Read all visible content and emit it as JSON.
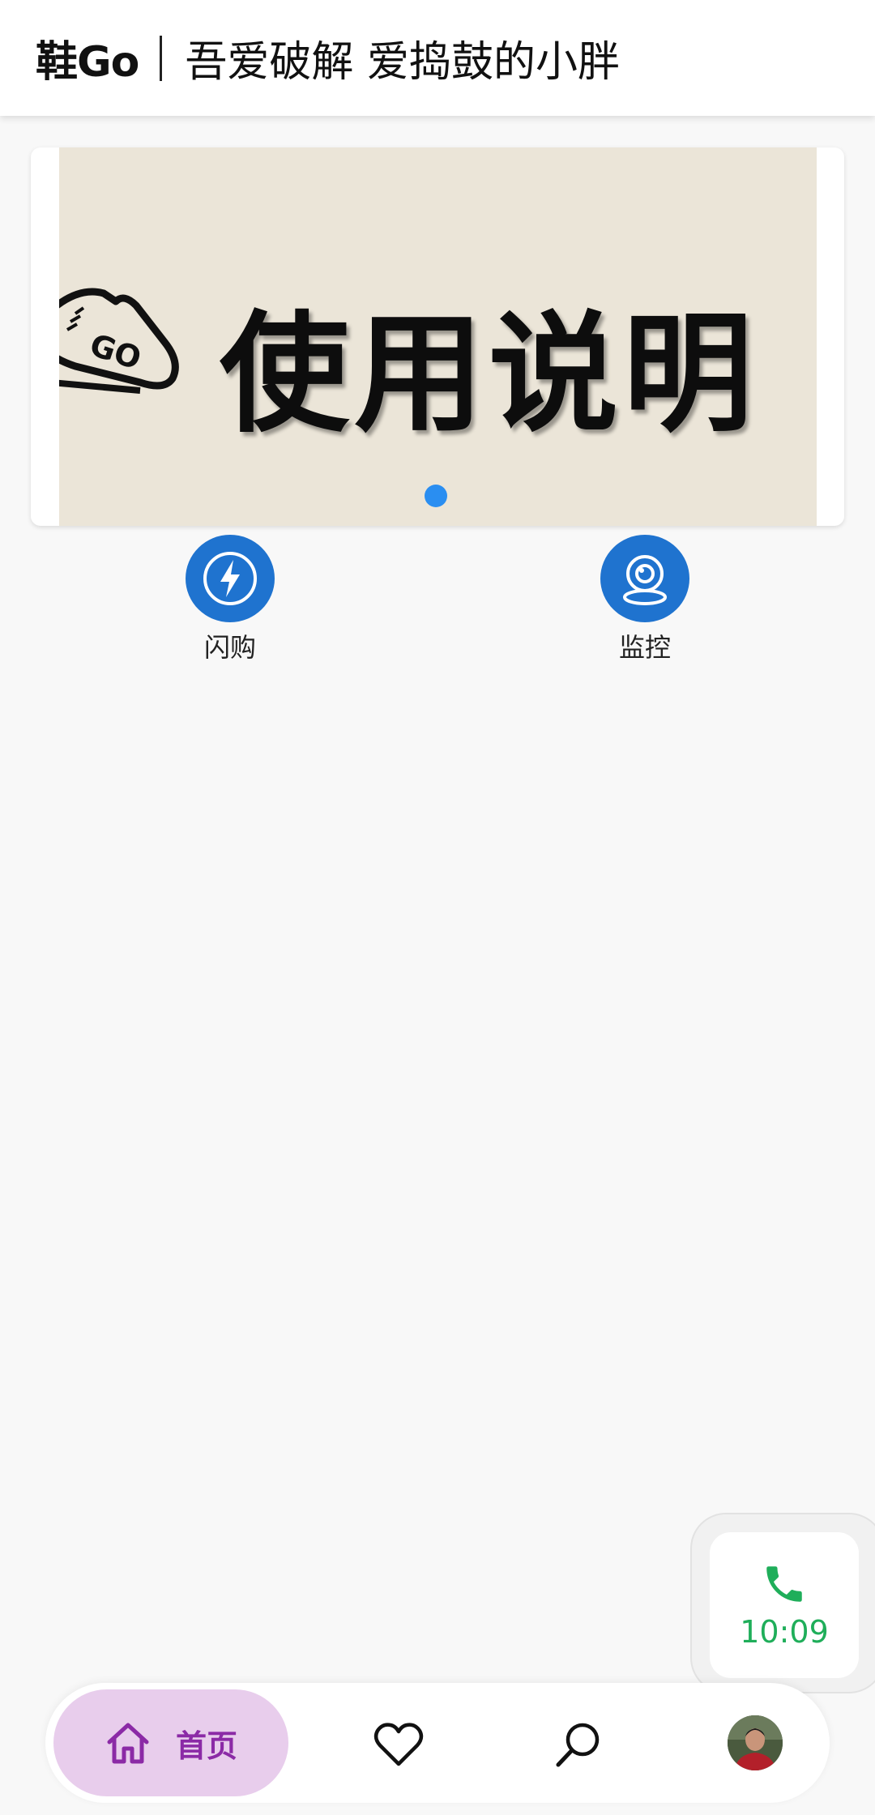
{
  "header": {
    "app_name": "鞋Go",
    "subtitle": "吾爱破解 爱捣鼓的小胖"
  },
  "banner": {
    "text": "使用说明",
    "logo_text": "GO",
    "active_dot_color": "#2a8ef1"
  },
  "actions": [
    {
      "label": "闪购",
      "icon": "lightning-icon"
    },
    {
      "label": "监控",
      "icon": "webcam-icon"
    }
  ],
  "call_widget": {
    "time": "10:09",
    "icon": "phone-icon",
    "color": "#1fae5a"
  },
  "bottom_nav": {
    "home_label": "首页",
    "accent": "#8b2aa6",
    "items": [
      "home-icon",
      "heart-icon",
      "search-icon",
      "avatar"
    ]
  }
}
